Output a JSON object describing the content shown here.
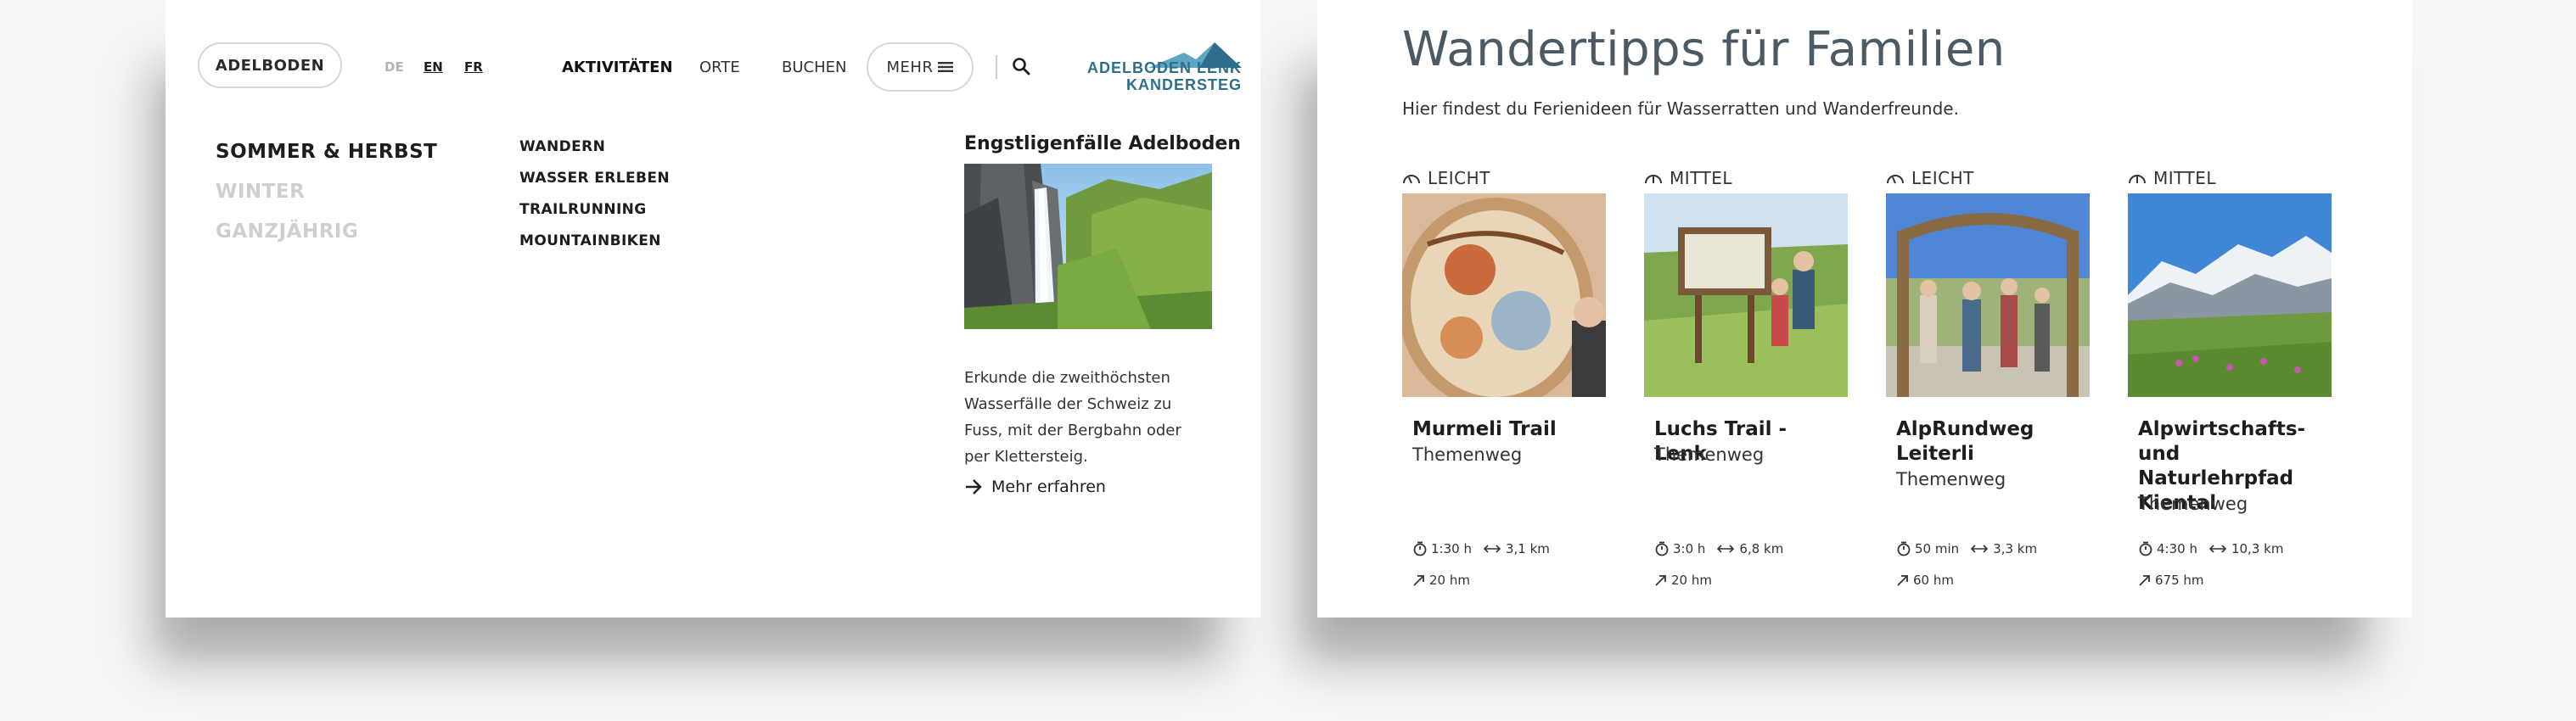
{
  "header": {
    "region_button": "ADELBODEN",
    "languages": [
      "DE",
      "EN",
      "FR"
    ],
    "nav": [
      "AKTIVITÄTEN",
      "ORTE",
      "BUCHEN"
    ],
    "more_label": "MEHR",
    "logo_line1": "ADELBODEN LENK",
    "logo_line2": "KANDERSTEG"
  },
  "menu": {
    "seasons": [
      "SOMMER & HERBST",
      "WINTER",
      "GANZJÄHRIG"
    ],
    "subitems": [
      "WANDERN",
      "WASSER ERLEBEN",
      "TRAILRUNNING",
      "MOUNTAINBIKEN"
    ]
  },
  "feature": {
    "title": "Engstligenfälle Adelboden",
    "text": "Erkunde die zweithöchsten Wasserfälle der Schweiz zu Fuss, mit der Bergbahn oder per Klettersteig.",
    "link": "Mehr erfahren"
  },
  "page": {
    "title": "Wandertipps für Familien",
    "subtitle": "Hier findest du Ferienideen für Wasserratten und Wanderfreunde."
  },
  "cards": [
    {
      "difficulty": "LEICHT",
      "title": "Murmeli Trail",
      "type": "Themenweg",
      "duration": "1:30 h",
      "distance": "3,1 km",
      "elevation": "20 hm"
    },
    {
      "difficulty": "MITTEL",
      "title": "Luchs Trail - Lenk",
      "type": "Themenweg",
      "duration": "3:0 h",
      "distance": "6,8 km",
      "elevation": "20 hm"
    },
    {
      "difficulty": "LEICHT",
      "title": "AlpRundweg Leiterli",
      "type": "Themenweg",
      "duration": "50 min",
      "distance": "3,3 km",
      "elevation": "60 hm"
    },
    {
      "difficulty": "MITTEL",
      "title": "Alpwirtschafts- und Naturlehrpfad Kiental",
      "type": "Themenweg",
      "duration": "4:30 h",
      "distance": "10,3 km",
      "elevation": "675 hm"
    }
  ],
  "colors": {
    "brand": "#2e6e8a",
    "title": "#4b5b66",
    "inactive": "#cfcfcf"
  },
  "icons": [
    "search-icon",
    "menu-icon",
    "arrow-right-icon",
    "gauge-icon",
    "stopwatch-icon",
    "distance-icon",
    "ascent-icon"
  ]
}
